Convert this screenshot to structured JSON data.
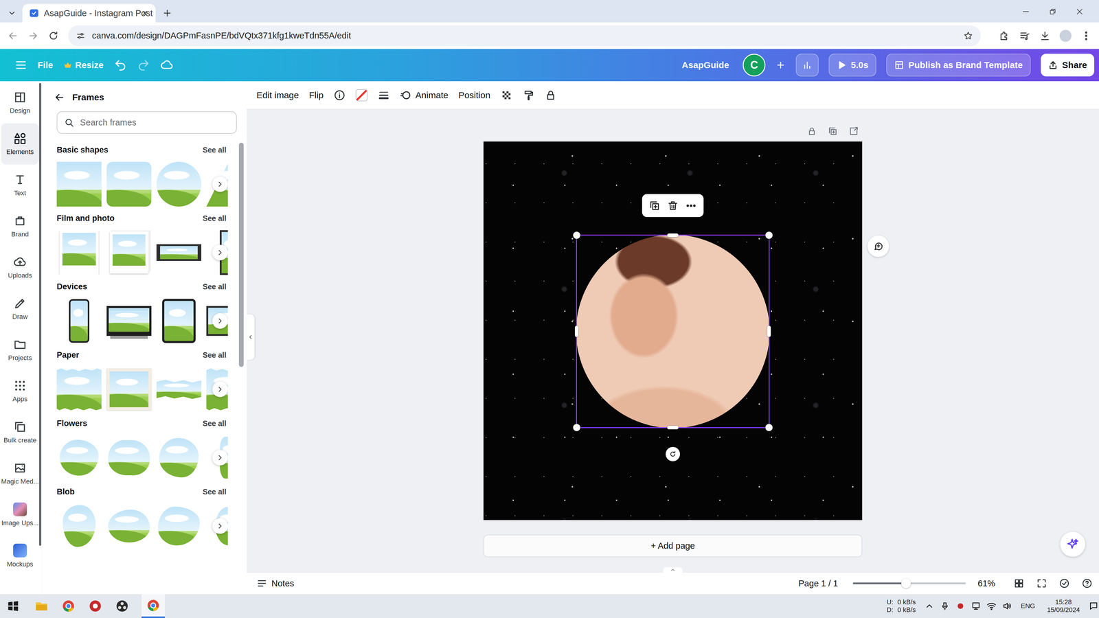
{
  "browser": {
    "tab": {
      "title": "AsapGuide - Instagram Post",
      "selected": true
    },
    "url": "canva.com/design/DAGPmFasnPE/bdVQtx371kfg1kweTdn55A/edit"
  },
  "topbar": {
    "file": "File",
    "resize": "Resize",
    "team": "AsapGuide",
    "avatar": "C",
    "timer": "5.0s",
    "publish": "Publish as Brand Template",
    "share": "Share"
  },
  "rail": [
    {
      "label": "Design",
      "selected": false
    },
    {
      "label": "Elements",
      "selected": true
    },
    {
      "label": "Text",
      "selected": false
    },
    {
      "label": "Brand",
      "selected": false
    },
    {
      "label": "Uploads",
      "selected": false
    },
    {
      "label": "Draw",
      "selected": false
    },
    {
      "label": "Projects",
      "selected": false
    },
    {
      "label": "Apps",
      "selected": false
    },
    {
      "label": "Bulk create",
      "selected": false
    },
    {
      "label": "Magic Med...",
      "selected": false
    },
    {
      "label": "Image Ups...",
      "selected": false
    },
    {
      "label": "Mockups",
      "selected": false
    }
  ],
  "panel": {
    "title": "Frames",
    "search_placeholder": "Search frames",
    "categories": [
      {
        "title": "Basic shapes",
        "see_all": "See all",
        "items": [
          {
            "kind": "square"
          },
          {
            "kind": "rounded"
          },
          {
            "kind": "circle"
          },
          {
            "kind": "triangle"
          }
        ]
      },
      {
        "title": "Film and photo",
        "see_all": "See all",
        "items": [
          {
            "kind": "polaroid"
          },
          {
            "kind": "stack"
          },
          {
            "kind": "strip"
          },
          {
            "kind": "film"
          }
        ]
      },
      {
        "title": "Devices",
        "see_all": "See all",
        "items": [
          {
            "kind": "phone"
          },
          {
            "kind": "monitor"
          },
          {
            "kind": "tablet"
          },
          {
            "kind": "laptop"
          }
        ]
      },
      {
        "title": "Paper",
        "see_all": "See all",
        "items": [
          {
            "kind": "torn"
          },
          {
            "kind": "tornborder"
          },
          {
            "kind": "ribbon"
          },
          {
            "kind": "torn"
          }
        ]
      },
      {
        "title": "Flowers",
        "see_all": "See all",
        "items": [
          {
            "kind": "leafy"
          },
          {
            "kind": "cloud"
          },
          {
            "kind": "clover"
          },
          {
            "kind": "wreath"
          }
        ]
      },
      {
        "title": "Blob",
        "see_all": "See all",
        "items": [
          {
            "kind": "bloba"
          },
          {
            "kind": "blobb"
          },
          {
            "kind": "blobc"
          },
          {
            "kind": "blobd"
          }
        ]
      }
    ]
  },
  "toolbar": {
    "edit_image": "Edit image",
    "flip": "Flip",
    "animate": "Animate",
    "position": "Position"
  },
  "canvas": {
    "image_selected": true
  },
  "add_page": "+ Add page",
  "footer": {
    "notes": "Notes",
    "page": "Page 1 / 1",
    "zoom": {
      "level": 0.47,
      "reading": "61%"
    }
  },
  "taskbar": {
    "upload_label": "U:",
    "download_label": "D:",
    "upload_rate": "0 kB/s",
    "download_rate": "0 kB/s",
    "language": "ENG",
    "time": "15:28",
    "date": "15/09/2024"
  }
}
